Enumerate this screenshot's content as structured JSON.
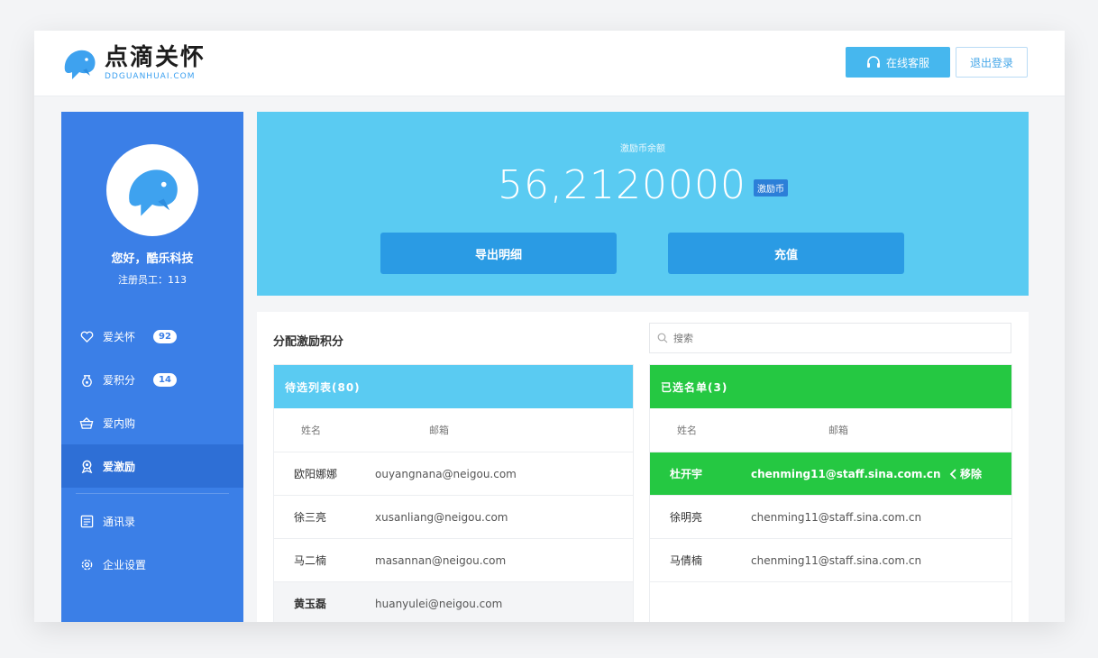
{
  "brand": {
    "name_cn": "点滴关怀",
    "name_en": "DDGUANHUAI.COM"
  },
  "header": {
    "service_label": "在线客服",
    "logout_label": "退出登录"
  },
  "user": {
    "greeting": "您好，酷乐科技",
    "employees": "注册员工：113"
  },
  "nav": [
    {
      "label": "爱关怀",
      "badge": "92",
      "icon": "heart-tag-icon"
    },
    {
      "label": "爱积分",
      "badge": "14",
      "icon": "points-bag-icon"
    },
    {
      "label": "爱内购",
      "badge": "",
      "icon": "basket-icon"
    },
    {
      "label": "爱激励",
      "badge": "",
      "icon": "award-icon"
    },
    {
      "label": "通讯录",
      "badge": "",
      "icon": "contacts-icon"
    },
    {
      "label": "企业设置",
      "badge": "",
      "icon": "gear-icon"
    }
  ],
  "balance": {
    "label": "激励币余额",
    "value": "56,2120000",
    "unit": "激励币",
    "export_label": "导出明细",
    "recharge_label": "充值"
  },
  "assign": {
    "title": "分配激励积分",
    "search_placeholder": "搜索",
    "pending": {
      "title": "待选列表(80)",
      "col_name": "姓名",
      "col_email": "邮箱",
      "rows": [
        {
          "name": "欧阳娜娜",
          "email": "ouyangnana@neigou.com"
        },
        {
          "name": "徐三亮",
          "email": "xusanliang@neigou.com"
        },
        {
          "name": "马二楠",
          "email": "masannan@neigou.com"
        },
        {
          "name": "黄玉磊",
          "email": "huanyulei@neigou.com"
        }
      ]
    },
    "selected": {
      "title": "已选名单(3)",
      "col_name": "姓名",
      "col_email": "邮箱",
      "remove_label": "移除",
      "rows": [
        {
          "name": "杜开宇",
          "email": "chenming11@staff.sina.com.cn"
        },
        {
          "name": "徐明亮",
          "email": "chenming11@staff.sina.com.cn"
        },
        {
          "name": "马倩楠",
          "email": "chenming11@staff.sina.com.cn"
        }
      ]
    }
  },
  "colors": {
    "sidebar": "#3b7fe7",
    "banner": "#5acbf2",
    "pending_head": "#5acbf2",
    "selected_head": "#25c842",
    "button": "#2a9be4"
  }
}
